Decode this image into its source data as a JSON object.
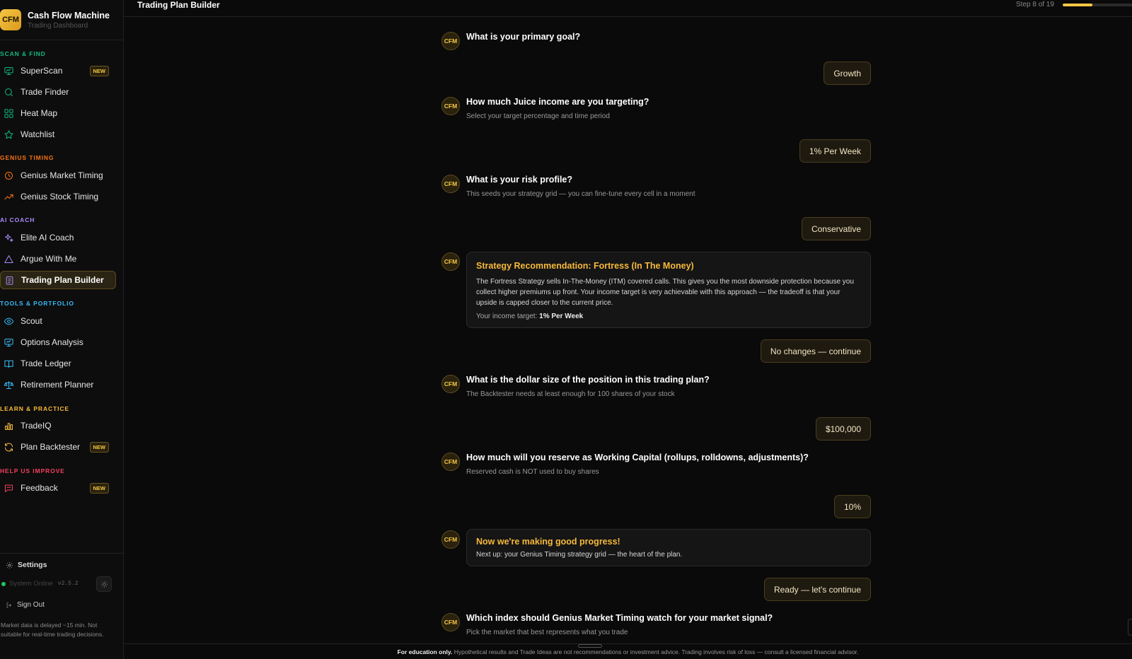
{
  "brand": {
    "logo": "CFM",
    "title": "Cash Flow Machine",
    "subtitle": "Trading Dashboard"
  },
  "sections": [
    {
      "label": "SCAN & FIND",
      "color": "#10b981"
    },
    {
      "label": "GENIUS TIMING",
      "color": "#f97316"
    },
    {
      "label": "AI COACH",
      "color": "#a78bfa"
    },
    {
      "label": "TOOLS & PORTFOLIO",
      "color": "#38bdf8"
    },
    {
      "label": "LEARN & PRACTICE",
      "color": "#f6b93b"
    },
    {
      "label": "HELP US IMPROVE",
      "color": "#f43f5e"
    }
  ],
  "nav": {
    "superscan": "SuperScan",
    "trade_finder": "Trade Finder",
    "heat_map": "Heat Map",
    "watchlist": "Watchlist",
    "genius_market": "Genius Market Timing",
    "genius_stock": "Genius Stock Timing",
    "elite_ai": "Elite AI Coach",
    "argue": "Argue With Me",
    "plan_builder": "Trading Plan Builder",
    "scout": "Scout",
    "options": "Options Analysis",
    "ledger": "Trade Ledger",
    "retirement": "Retirement Planner",
    "tradeiq": "TradeIQ",
    "backtester": "Plan Backtester",
    "feedback": "Feedback",
    "new_badge": "NEW"
  },
  "footer_sidebar": {
    "settings": "Settings",
    "status": "System Online",
    "version": "v2.5.2",
    "signout": "Sign Out",
    "disclaimer": "Market data is delayed ~15 min. Not suitable for real-time trading decisions."
  },
  "topbar": {
    "title": "Trading Plan Builder",
    "step": "Step 8 of 19",
    "progress_fraction": 0.42
  },
  "chat": {
    "avatar": "CFM",
    "q1": "What is your primary goal?",
    "a1": "Growth",
    "q2": "How much Juice income are you targeting?",
    "q2_sub": "Select your target percentage and time period",
    "a2": "1% Per Week",
    "q3": "What is your risk profile?",
    "q3_sub": "This seeds your strategy grid — you can fine-tune every cell in a moment",
    "a3": "Conservative",
    "rec_title": "Strategy Recommendation: Fortress (In The Money)",
    "rec_body": "The Fortress Strategy sells In-The-Money (ITM) covered calls. This gives you the most downside protection because you collect higher premiums up front. Your income target is very achievable with this approach — the tradeoff is that your upside is capped closer to the current price.",
    "rec_foot_label": "Your income target: ",
    "rec_foot_value": "1% Per Week",
    "a4": "No changes — continue",
    "q5": "What is the dollar size of the position in this trading plan?",
    "q5_sub": "The Backtester needs at least enough for 100 shares of your stock",
    "a5": "$100,000",
    "q6": "How much will you reserve as Working Capital (rollups, rolldowns, adjustments)?",
    "q6_sub": "Reserved cash is NOT used to buy shares",
    "a6": "10%",
    "prog_title": "Now we're making good progress!",
    "prog_body": "Next up: your Genius Timing strategy grid — the heart of the plan.",
    "a7": "Ready — let's continue",
    "q8": "Which index should Genius Market Timing watch for your market signal?",
    "q8_sub": "Pick the market that best represents what you trade"
  },
  "footer": {
    "bold": "For education only.",
    "text": " Hypothetical results and Trade Ideas are not recommendations or investment advice. Trading involves risk of loss — consult a licensed financial advisor."
  }
}
